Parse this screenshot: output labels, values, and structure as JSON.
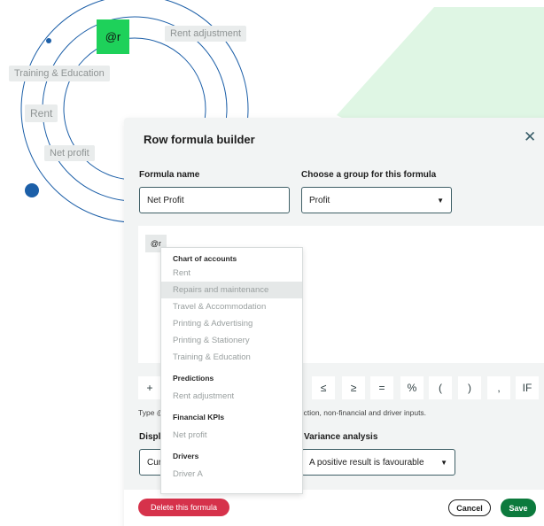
{
  "background": {
    "tag_at": "@r",
    "rent_adjustment": "Rent adjustment",
    "training": "Training & Education",
    "rent": "Rent",
    "net_profit": "Net profit"
  },
  "modal": {
    "title": "Row formula builder",
    "formula_name_label": "Formula name",
    "formula_name_value": "Net Profit",
    "group_label": "Choose a group for this formula",
    "group_value": "Profit",
    "formula_token": "@r",
    "operators": [
      "+",
      "≤",
      "≥",
      "=",
      "%",
      "(",
      ")",
      ",",
      "IF"
    ],
    "hint_prefix": "Type @",
    "hint_suffix": "rediction, non-financial and driver inputs.",
    "display_label": "Displ",
    "display_value": "Cur",
    "variance_label": "Variance analysis",
    "variance_value": "A positive result is favourable"
  },
  "dropdown": {
    "group1_header": "Chart of accounts",
    "group1_items": [
      "Rent",
      "Repairs and maintenance",
      "Travel & Accommodation",
      "Printing & Advertising",
      "Printing & Stationery",
      "Training & Education"
    ],
    "group2_header": "Predictions",
    "group2_items": [
      "Rent adjustment"
    ],
    "group3_header": "Financial KPIs",
    "group3_items": [
      "Net profit"
    ],
    "group4_header": "Drivers",
    "group4_items": [
      "Driver A"
    ]
  },
  "footer": {
    "delete_label": "Delete this formula",
    "cancel_label": "Cancel",
    "save_label": "Save"
  },
  "colors": {
    "accent_green": "#1ed15a",
    "save_green": "#0c7a3d",
    "delete_red": "#d6324b",
    "orbit_blue": "#1c5fa8"
  }
}
